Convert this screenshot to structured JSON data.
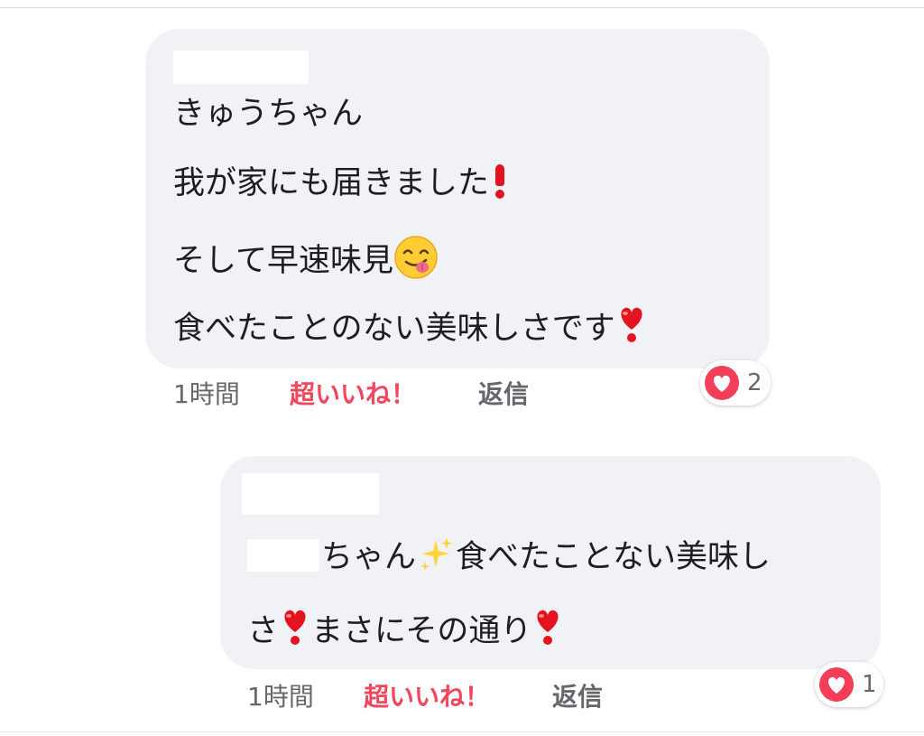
{
  "colors": {
    "bubble_bg": "#f0f2f5",
    "like_accent": "#f0475c",
    "heart_red": "#f33e58",
    "exclamation_red": "#e0141e",
    "meta_gray": "#65676b"
  },
  "comments": [
    {
      "lines": [
        [
          "きゅうちゃん"
        ],
        [
          "我が家にも届きました",
          {
            "icon": "exclamation-icon"
          }
        ],
        [
          "そして早速味見",
          {
            "icon": "face-savoring-food-icon"
          }
        ],
        [
          "食べたことのない美味しさです",
          {
            "icon": "heart-exclamation-icon"
          }
        ]
      ],
      "line1": "きゅうちゃん",
      "line2": "我が家にも届きました",
      "line3": "そして早速味見",
      "line4": "食べたことのない美味しさです",
      "time": "1時間",
      "like_label": "超いいね！",
      "reply_label": "返信",
      "reaction": {
        "icon": "heart-reaction-icon",
        "count": "2"
      }
    },
    {
      "line1_a": "ちゃん",
      "line1_b": "食べたことない美味し",
      "line2_a": "さ",
      "line2_b": "まさにその通り",
      "icons": [
        "sparkles-icon",
        "heart-exclamation-icon"
      ],
      "time": "1時間",
      "like_label": "超いいね！",
      "reply_label": "返信",
      "reaction": {
        "icon": "heart-reaction-icon",
        "count": "1"
      }
    }
  ]
}
